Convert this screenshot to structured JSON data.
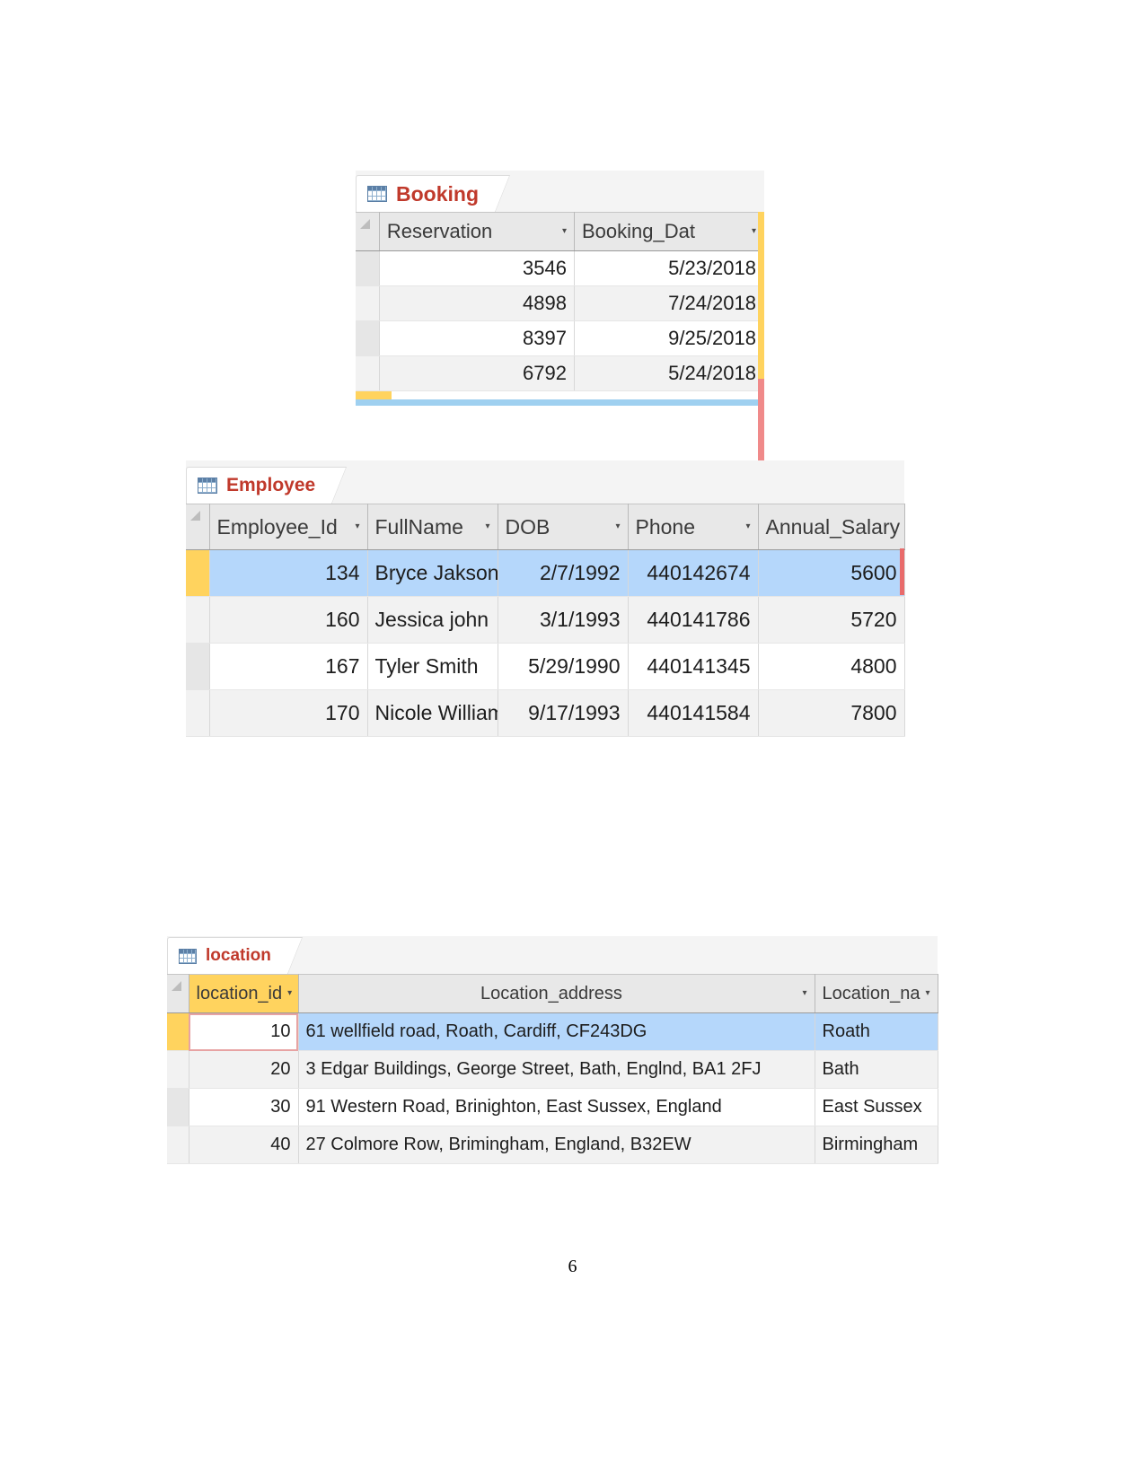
{
  "page": {
    "number": "6"
  },
  "tables": [
    {
      "id": "booking",
      "tab": {
        "label": "Booking",
        "icon": "table-grid-icon"
      },
      "columns": [
        {
          "label": "Reservation",
          "align": "right",
          "dropdown": "▾"
        },
        {
          "label": "Booking_Dat",
          "align": "right",
          "dropdown": "▾"
        }
      ],
      "rows": [
        {
          "cells": [
            "3546",
            "5/23/2018"
          ]
        },
        {
          "cells": [
            "4898",
            "7/24/2018"
          ]
        },
        {
          "cells": [
            "8397",
            "9/25/2018"
          ]
        },
        {
          "cells": [
            "6792",
            "5/24/2018"
          ]
        }
      ]
    },
    {
      "id": "employee",
      "tab": {
        "label": "Employee",
        "icon": "table-grid-icon"
      },
      "columns": [
        {
          "label": "Employee_Id",
          "align": "right",
          "dropdown": "▾"
        },
        {
          "label": "FullName",
          "align": "left",
          "dropdown": "▾"
        },
        {
          "label": "DOB",
          "align": "right",
          "dropdown": "▾"
        },
        {
          "label": "Phone",
          "align": "right",
          "dropdown": "▾"
        },
        {
          "label": "Annual_Salary",
          "align": "right",
          "dropdown": "▾"
        }
      ],
      "rows": [
        {
          "cells": [
            "134",
            "Bryce Jakson",
            "2/7/1992",
            "440142674",
            "5600"
          ],
          "selected": true
        },
        {
          "cells": [
            "160",
            "Jessica john",
            "3/1/1993",
            "440141786",
            "5720"
          ]
        },
        {
          "cells": [
            "167",
            "Tyler Smith",
            "5/29/1990",
            "440141345",
            "4800"
          ]
        },
        {
          "cells": [
            "170",
            "Nicole William",
            "9/17/1993",
            "440141584",
            "7800"
          ]
        }
      ]
    },
    {
      "id": "location",
      "tab": {
        "label": "location",
        "icon": "table-grid-icon"
      },
      "columns": [
        {
          "label": "location_id",
          "align": "right",
          "dropdown": "▾",
          "highlighted": true
        },
        {
          "label": "Location_address",
          "align": "center",
          "dropdown": "▾"
        },
        {
          "label": "Location_na",
          "align": "left",
          "dropdown": "▾"
        }
      ],
      "rows": [
        {
          "cells": [
            "10",
            "61 wellfield road, Roath, Cardiff, CF243DG",
            "Roath"
          ],
          "selected": true
        },
        {
          "cells": [
            "20",
            "3 Edgar Buildings, George Street, Bath, Englnd, BA1 2FJ",
            "Bath"
          ]
        },
        {
          "cells": [
            "30",
            "91 Western Road, Brinighton, East Sussex, England",
            "East Sussex"
          ]
        },
        {
          "cells": [
            "40",
            "27 Colmore Row, Brimingham, England, B32EW",
            "Birmingham"
          ]
        }
      ]
    }
  ],
  "colors": {
    "tab_text": "#c0392b",
    "selection": "#b5d7fb",
    "highlight": "#ffd35e",
    "active_cell_border": "#e7a3a3"
  }
}
